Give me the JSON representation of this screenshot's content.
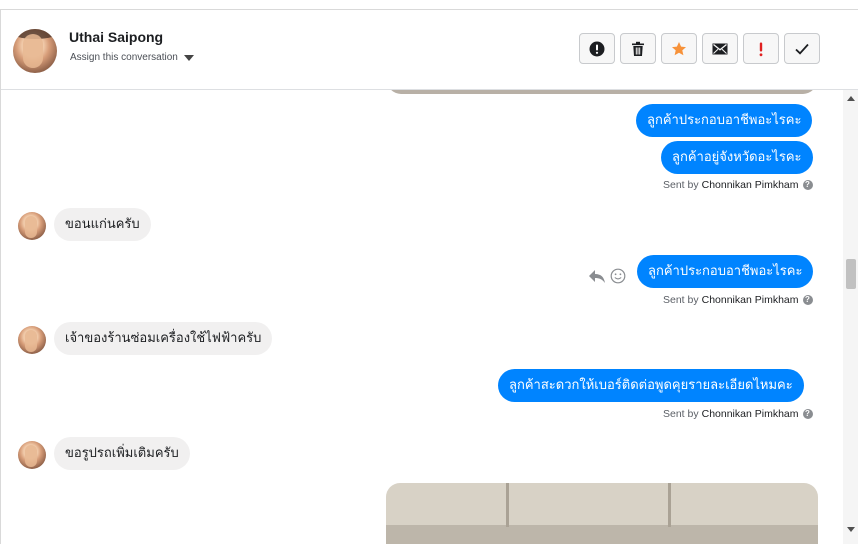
{
  "contact": {
    "name": "Uthai Saipong",
    "assign_label": "Assign this conversation"
  },
  "toolbar": {
    "buttons": [
      {
        "name": "report-spam",
        "icon": "alert-circle-icon"
      },
      {
        "name": "delete",
        "icon": "trash-icon"
      },
      {
        "name": "star",
        "icon": "star-icon",
        "color": "#f7923a"
      },
      {
        "name": "mark-unread",
        "icon": "envelope-icon"
      },
      {
        "name": "follow-up",
        "icon": "exclamation-icon",
        "color": "#e02020"
      },
      {
        "name": "mark-done",
        "icon": "check-icon"
      }
    ]
  },
  "messages": [
    {
      "direction": "out",
      "text": "ลูกค้าประกอบอาชีพอะไรคะ"
    },
    {
      "direction": "out",
      "text": "ลูกค้าอยู่จังหวัดอะไรคะ"
    },
    {
      "direction": "in",
      "text": "ขอนแก่นครับ"
    },
    {
      "direction": "out",
      "text": "ลูกค้าประกอบอาชีพอะไรคะ"
    },
    {
      "direction": "in",
      "text": "เจ้าของร้านซ่อมเครื่องใช้ไฟฟ้าครับ"
    },
    {
      "direction": "out",
      "text": "ลูกค้าสะดวกให้เบอร์ติดต่อพูดคุยรายละเอียดไหมคะ"
    },
    {
      "direction": "in",
      "text": "ขอรูปรถเพิ่มเติมครับ"
    }
  ],
  "sent_by": {
    "prefix": "Sent by",
    "agent": "Chonnikan Pimkham",
    "help": "?"
  },
  "colors": {
    "outgoing_bubble": "#0084ff",
    "incoming_bubble": "#f1f0f0"
  }
}
